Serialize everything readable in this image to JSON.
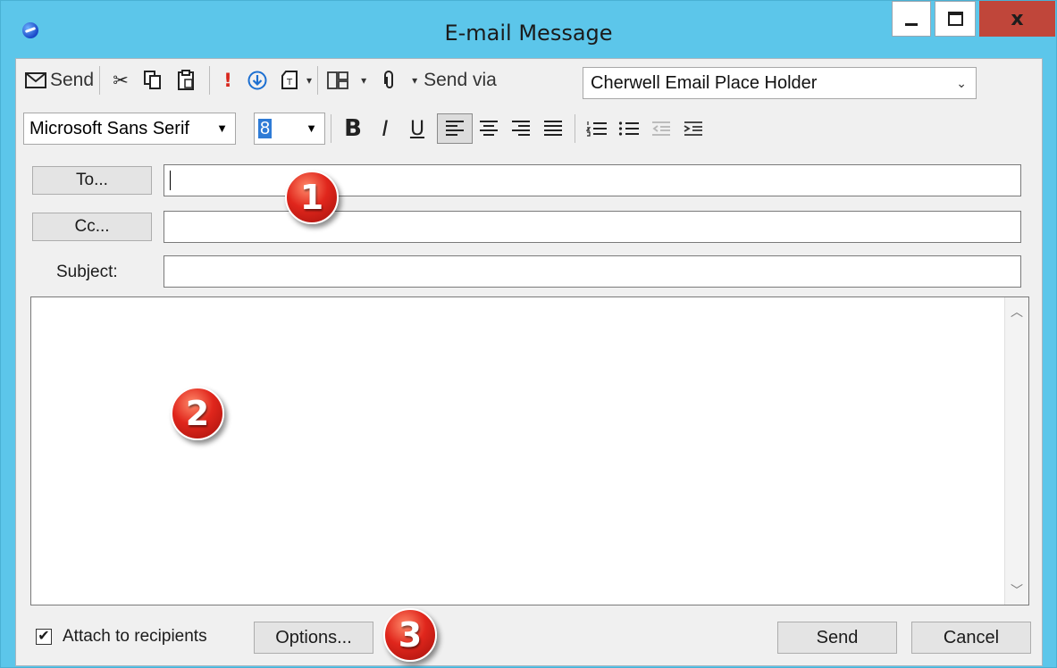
{
  "window": {
    "title": "E-mail Message",
    "close_label": "x"
  },
  "toolbar1": {
    "send_label": "Send",
    "send_via_label": "Send via",
    "send_via_value": "Cherwell Email Place Holder"
  },
  "toolbar2": {
    "font": "Microsoft Sans Serif",
    "size": "8",
    "bold": "B",
    "italic": "I",
    "underline": "U"
  },
  "fields": {
    "to_label": "To...",
    "cc_label": "Cc...",
    "subject_label": "Subject:"
  },
  "footer": {
    "attach_label": "Attach to recipients",
    "attach_checked": true,
    "options_label": "Options...",
    "send_label": "Send",
    "cancel_label": "Cancel"
  },
  "callouts": [
    "1",
    "2",
    "3"
  ],
  "colors": {
    "titlebar": "#5cc6ea",
    "close": "#c0463a",
    "callout": "#e0261c"
  }
}
